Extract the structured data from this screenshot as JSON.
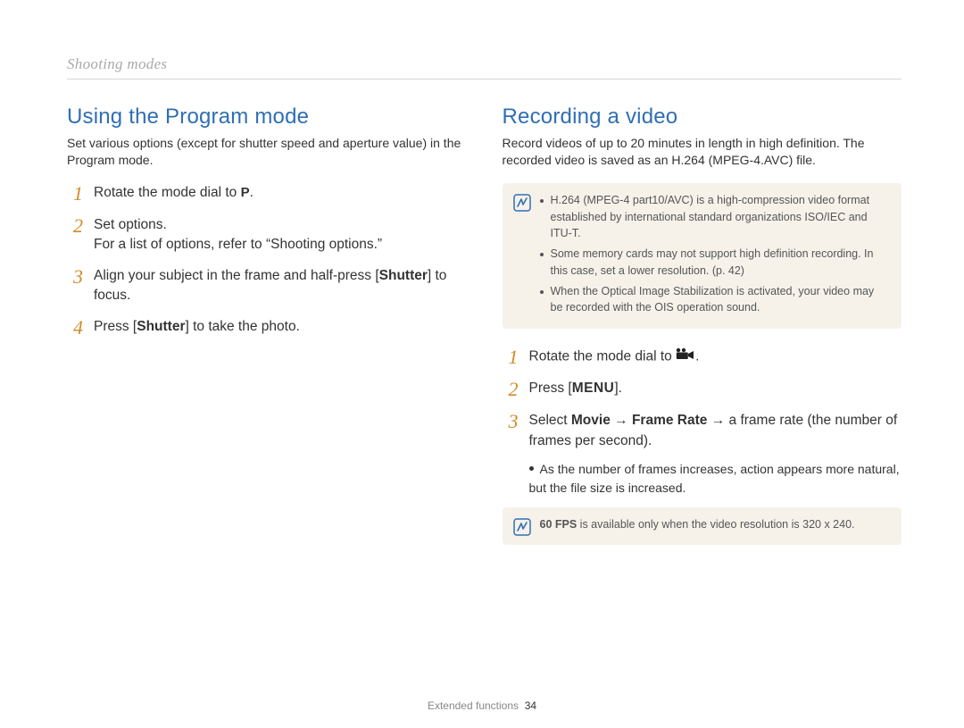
{
  "breadcrumb": "Shooting modes",
  "left": {
    "heading": "Using the Program mode",
    "intro": "Set various options (except for shutter speed and aperture value) in the Program mode.",
    "steps": [
      {
        "num": "1",
        "text_before": "Rotate the mode dial to ",
        "icon": "P",
        "text_after": "."
      },
      {
        "num": "2",
        "text": "Set options.",
        "sub_plain": "For a list of options, refer to “Shooting options.”"
      },
      {
        "num": "3",
        "text_before": "Align your subject in the frame and half-press [",
        "bold": "Shutter",
        "text_after": "] to focus."
      },
      {
        "num": "4",
        "text_before": "Press [",
        "bold": "Shutter",
        "text_after": "] to take the photo."
      }
    ]
  },
  "right": {
    "heading": "Recording a video",
    "intro": "Record videos of up to 20 minutes in length in high definition. The recorded video is saved as an H.264 (MPEG-4.AVC) file.",
    "note1": [
      "H.264 (MPEG-4 part10/AVC) is a high-compression video format established by international standard organizations ISO/IEC and ITU-T.",
      "Some memory cards may not support high definition recording. In this case, set a lower resolution. (p. 42)",
      "When the Optical Image Stabilization is activated, your video may be recorded with the OIS operation sound."
    ],
    "steps": [
      {
        "num": "1",
        "text_before": "Rotate the mode dial to ",
        "icon": "movie",
        "text_after": "."
      },
      {
        "num": "2",
        "text_before": "Press [",
        "menu": "MENU",
        "text_after": "]."
      },
      {
        "num": "3",
        "s3_before": "Select ",
        "s3_b1": "Movie",
        "s3_arrow1": " → ",
        "s3_b2": "Frame Rate",
        "s3_arrow2": " → ",
        "s3_after": "a frame rate (the number of frames per second).",
        "bullet": "As the number of frames increases, action appears more natural, but the file size is increased."
      }
    ],
    "note2_bold": "60 FPS",
    "note2_rest": " is available only when the video resolution is 320 x 240."
  },
  "footer": {
    "label": "Extended functions",
    "page": "34"
  }
}
